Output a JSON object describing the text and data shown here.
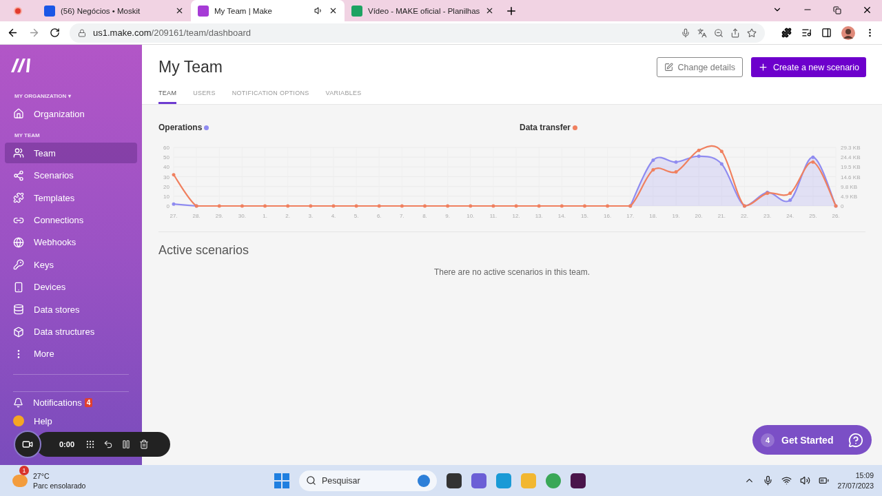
{
  "browser": {
    "tabs": [
      {
        "title": "(56) Negócios • Moskit",
        "selected": false,
        "kind": "moskit"
      },
      {
        "title": "My Team | Make",
        "selected": true,
        "kind": "make"
      },
      {
        "title": "Vídeo - MAKE oficial - Planilhas",
        "selected": false,
        "kind": "sheets"
      }
    ],
    "url_domain": "us1.make.com",
    "url_path": "/209161/team/dashboard"
  },
  "sidebar": {
    "org_label": "MY ORGANIZATION",
    "org_caret": "▾",
    "org_items": [
      {
        "label": "Organization",
        "selected": false
      }
    ],
    "team_label": "MY TEAM",
    "items": [
      {
        "label": "Team",
        "selected": true
      },
      {
        "label": "Scenarios",
        "selected": false
      },
      {
        "label": "Templates",
        "selected": false
      },
      {
        "label": "Connections",
        "selected": false
      },
      {
        "label": "Webhooks",
        "selected": false
      },
      {
        "label": "Keys",
        "selected": false
      },
      {
        "label": "Devices",
        "selected": false
      },
      {
        "label": "Data stores",
        "selected": false
      },
      {
        "label": "Data structures",
        "selected": false
      },
      {
        "label": "More",
        "selected": false
      }
    ],
    "bottom_items": [
      {
        "label": "Notifications",
        "badge": "4"
      },
      {
        "label": "Help"
      }
    ]
  },
  "header": {
    "title": "My Team",
    "buttons": [
      "Change details",
      "Create a new scenario"
    ],
    "tabs": [
      {
        "label": "TEAM",
        "selected": true
      },
      {
        "label": "USERS",
        "selected": false
      },
      {
        "label": "NOTIFICATION OPTIONS",
        "selected": false
      },
      {
        "label": "VARIABLES",
        "selected": false
      }
    ]
  },
  "usage": {
    "right_axis": [
      "29.3 KB",
      "24.4 KB",
      "19.5 KB",
      "14.6 KB",
      "9.8 KB",
      "4.9 KB",
      "0"
    ],
    "chart_data": {
      "type": "line",
      "grid": true,
      "categories": [
        "27.",
        "28.",
        "29.",
        "30.",
        "1.",
        "2.",
        "3.",
        "4.",
        "5.",
        "6.",
        "7.",
        "8.",
        "9.",
        "10.",
        "11.",
        "12.",
        "13.",
        "14.",
        "15.",
        "16.",
        "17.",
        "18.",
        "19.",
        "20.",
        "21.",
        "22.",
        "23.",
        "24.",
        "25.",
        "26."
      ],
      "ylim": [
        0,
        60
      ],
      "yticks": [
        0,
        10,
        20,
        30,
        40,
        50,
        60
      ],
      "series": [
        {
          "name": "Operations",
          "color": "#8f8bf0",
          "values": [
            2,
            0,
            null,
            null,
            null,
            null,
            null,
            null,
            null,
            null,
            null,
            null,
            null,
            null,
            null,
            null,
            null,
            null,
            null,
            null,
            0,
            47,
            45,
            51,
            43,
            0,
            14,
            6,
            50,
            0
          ]
        },
        {
          "name": "Data transfer",
          "color": "#f0805f",
          "values": [
            32,
            0,
            0,
            0,
            0,
            0,
            0,
            0,
            0,
            0,
            0,
            0,
            0,
            0,
            0,
            0,
            0,
            0,
            0,
            0,
            0,
            37,
            35,
            57,
            56,
            0,
            13,
            13,
            45,
            0
          ]
        }
      ]
    }
  },
  "active": {
    "title": "Active scenarios",
    "empty": "There are no active scenarios in this team."
  },
  "get_started": {
    "count": "4",
    "label": "Get Started"
  },
  "recorder": {
    "time": "0:00"
  },
  "taskbar": {
    "temp": "27°C",
    "weather": "Parc ensolarado",
    "weather_badge": "1",
    "search": "Pesquisar",
    "time": "15:09",
    "date": "27/07/2023"
  }
}
